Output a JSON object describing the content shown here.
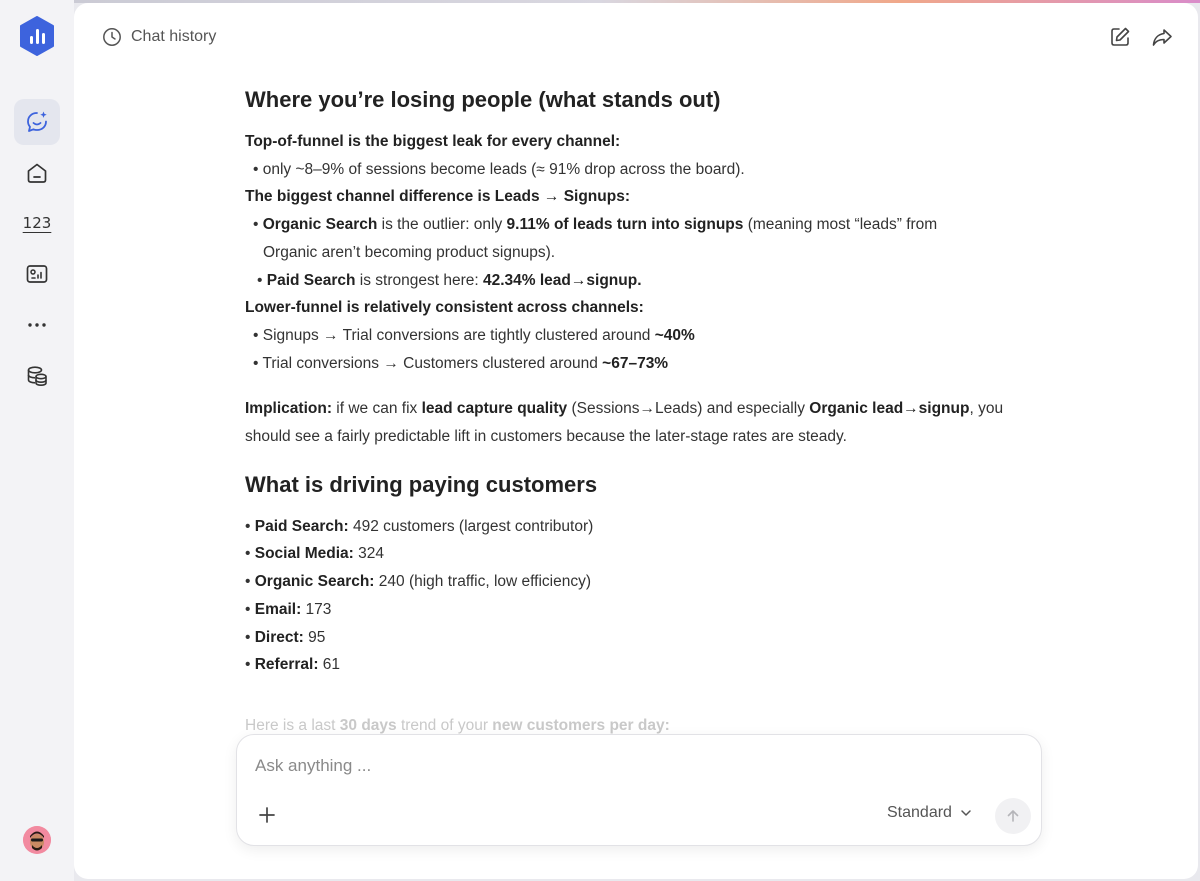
{
  "header": {
    "chat_history_label": "Chat history"
  },
  "sidebar": {
    "number_icon_label": "123"
  },
  "colors": {
    "brand": "#3d63dd",
    "sidebar_bg": "#f3f3f6",
    "main_bg": "#ffffff"
  },
  "content": {
    "section1": {
      "title": "Where you’re losing people (what stands out)",
      "l1_bold": "Top-of-funnel is the biggest leak for every channel:",
      "l2": "• only ~8–9% of sessions become leads (≈ 91% drop across the board).",
      "l3_bold": "The biggest channel difference is Leads → Signups:",
      "l4_pre": "• ",
      "l4_b1": "Organic Search",
      "l4_t1": " is the outlier: only ",
      "l4_b2": "9.11% of leads turn into signups",
      "l4_t2": " (meaning most “leads” from",
      "l5": "Organic aren’t becoming product signups).",
      "l6_pre": "• ",
      "l6_b1": "Paid Search",
      "l6_t1": " is strongest here: ",
      "l6_b2": "42.34% lead→signup.",
      "l7_bold": "Lower-funnel is relatively consistent across channels:",
      "l8_t": "• Signups → Trial conversions are tightly clustered around ",
      "l8_b": "~40%",
      "l9_t": "• Trial conversions → Customers clustered around ",
      "l9_b": "~67–73%",
      "imp_b1": "Implication:",
      "imp_t1": " if we can fix ",
      "imp_b2": "lead capture quality",
      "imp_t2": " (Sessions→Leads) and especially ",
      "imp_b3": "Organic lead→signup",
      "imp_t3": ", you",
      "imp_l2": "should see a fairly predictable lift in customers because the later-stage rates are steady."
    },
    "section2": {
      "title": "What is driving paying customers",
      "items": [
        {
          "label": "Paid Search:",
          "value": " 492 customers (largest contributor)"
        },
        {
          "label": "Social Media:",
          "value": " 324"
        },
        {
          "label": "Organic Search:",
          "value": " 240 (high traffic, low efficiency)"
        },
        {
          "label": "Email:",
          "value": " 173"
        },
        {
          "label": "Direct:",
          "value": " 95"
        },
        {
          "label": "Referral:",
          "value": " 61"
        }
      ],
      "faded_t1": "Here is a last ",
      "faded_b1": "30 days",
      "faded_t2": " trend of your ",
      "faded_b2": "new customers per day:"
    }
  },
  "composer": {
    "placeholder": "Ask anything ...",
    "value": "",
    "mode_label": "Standard"
  }
}
